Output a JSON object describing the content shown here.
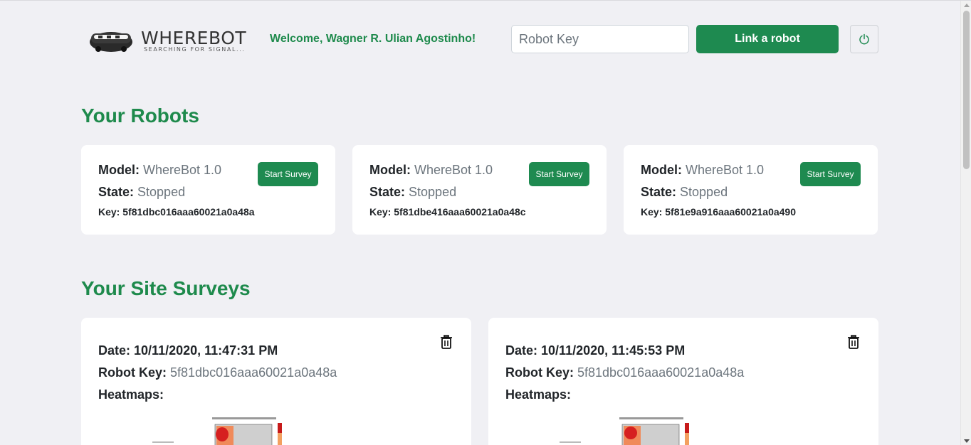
{
  "header": {
    "logo_word_a": "WHERE",
    "logo_word_b": "BOT",
    "logo_tagline": "SEARCHING FOR SIGNAL...",
    "welcome": "Welcome, Wagner R. Ulian Agostinho!",
    "robot_key_placeholder": "Robot Key",
    "link_button": "Link a robot"
  },
  "robots_section": {
    "title": "Your Robots",
    "model_label": "Model:",
    "state_label": "State:",
    "key_label": "Key:",
    "start_label": "Start Survey",
    "items": [
      {
        "model": "WhereBot 1.0",
        "state": "Stopped",
        "key": "5f81dbc016aaa60021a0a48a"
      },
      {
        "model": "WhereBot 1.0",
        "state": "Stopped",
        "key": "5f81dbe416aaa60021a0a48c"
      },
      {
        "model": "WhereBot 1.0",
        "state": "Stopped",
        "key": "5f81e9a916aaa60021a0a490"
      }
    ]
  },
  "surveys_section": {
    "title": "Your Site Surveys",
    "date_label": "Date:",
    "robot_key_label": "Robot Key:",
    "heatmaps_label": "Heatmaps:",
    "items": [
      {
        "date": "10/11/2020, 11:47:31 PM",
        "robot_key": "5f81dbc016aaa60021a0a48a"
      },
      {
        "date": "10/11/2020, 11:45:53 PM",
        "robot_key": "5f81dbc016aaa60021a0a48a"
      }
    ]
  },
  "colors": {
    "accent": "#1e8a50",
    "background": "#f0f0f4"
  },
  "icons": [
    "robot-vacuum-logo",
    "power-icon",
    "trash-icon"
  ]
}
